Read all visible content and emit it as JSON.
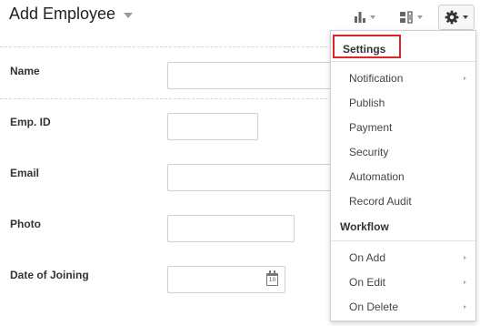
{
  "header": {
    "title": "Add Employee",
    "icons": [
      "bar-chart-icon",
      "layout-icon",
      "gear-icon"
    ]
  },
  "form": {
    "fields": [
      {
        "label": "Name"
      },
      {
        "label": "Emp. ID"
      },
      {
        "label": "Email"
      },
      {
        "label": "Photo"
      },
      {
        "label": "Date of Joining",
        "calendar_day": "10"
      }
    ]
  },
  "settings_menu": {
    "settings_heading": "Settings",
    "settings_items": [
      {
        "label": "Notification",
        "has_submenu": true
      },
      {
        "label": "Publish",
        "has_submenu": false
      },
      {
        "label": "Payment",
        "has_submenu": false
      },
      {
        "label": "Security",
        "has_submenu": false
      },
      {
        "label": "Automation",
        "has_submenu": false
      },
      {
        "label": "Record Audit",
        "has_submenu": false
      }
    ],
    "workflow_heading": "Workflow",
    "workflow_items": [
      {
        "label": "On Add",
        "has_submenu": true
      },
      {
        "label": "On Edit",
        "has_submenu": true
      },
      {
        "label": "On Delete",
        "has_submenu": true
      }
    ]
  },
  "colors": {
    "highlight_border": "#e0242c",
    "text": "#333333"
  }
}
